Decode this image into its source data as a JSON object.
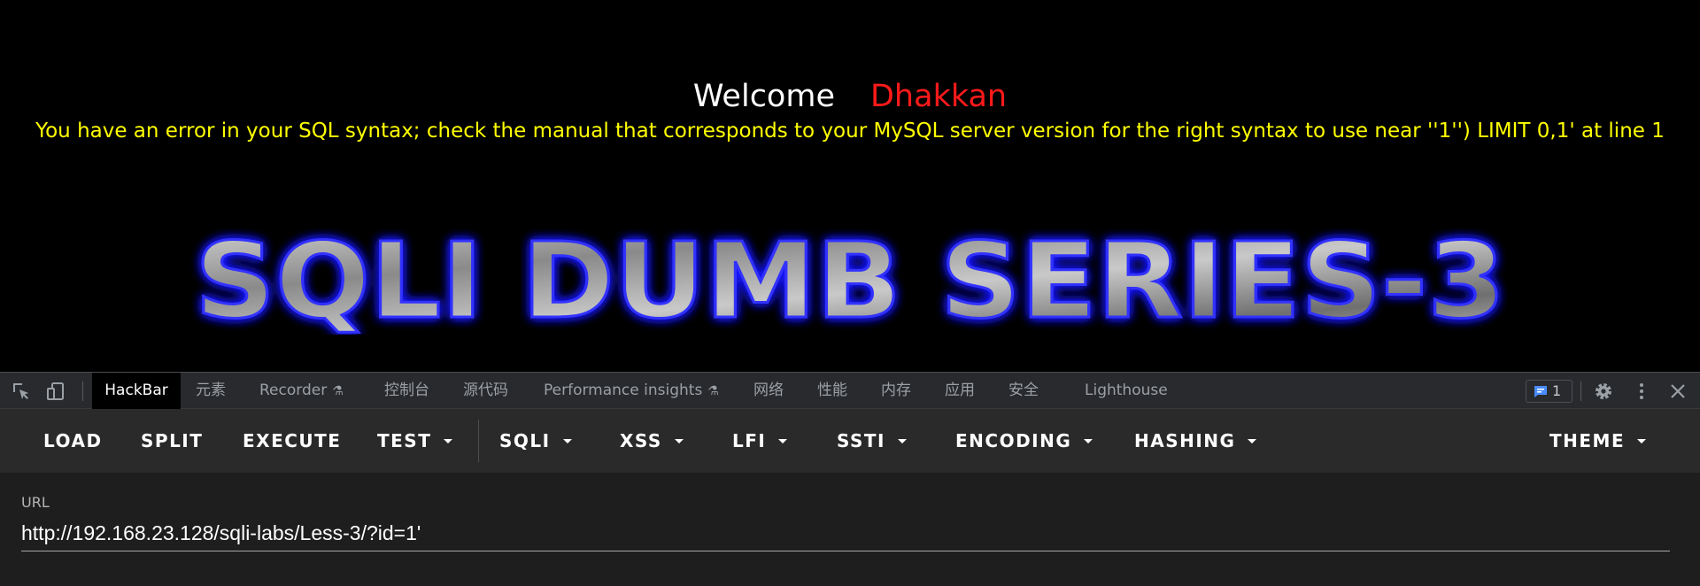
{
  "page": {
    "welcome_label": "Welcome",
    "username": "Dhakkan",
    "error_message": "You have an error in your SQL syntax; check the manual that corresponds to your MySQL server version for the right syntax to use near ''1'') LIMIT 0,1' at line 1",
    "banner_text": "SQLI DUMB SERIES-3",
    "colors": {
      "background": "#000000",
      "welcome": "#ffffff",
      "username": "#ff1a1a",
      "error": "#ffff00",
      "banner_glow": "#1a1aff"
    }
  },
  "devtools": {
    "tabs": [
      {
        "label": "HackBar",
        "active": true
      },
      {
        "label": "元素"
      },
      {
        "label": "Recorder",
        "icon": "flask-icon"
      },
      {
        "label": "控制台"
      },
      {
        "label": "源代码"
      },
      {
        "label": "Performance insights",
        "icon": "flask-icon"
      },
      {
        "label": "网络"
      },
      {
        "label": "性能"
      },
      {
        "label": "内存"
      },
      {
        "label": "应用"
      },
      {
        "label": "安全"
      },
      {
        "label": "Lighthouse"
      }
    ],
    "message_count": "1",
    "icons": [
      "inspect-icon",
      "device-toggle-icon",
      "message-icon",
      "settings-gear-icon",
      "more-vertical-icon",
      "close-icon"
    ]
  },
  "hackbar": {
    "buttons": [
      {
        "label": "LOAD"
      },
      {
        "label": "SPLIT"
      },
      {
        "label": "EXECUTE"
      },
      {
        "label": "TEST",
        "dropdown": true
      },
      {
        "label": "SQLI",
        "dropdown": true
      },
      {
        "label": "XSS",
        "dropdown": true
      },
      {
        "label": "LFI",
        "dropdown": true
      },
      {
        "label": "SSTI",
        "dropdown": true
      },
      {
        "label": "ENCODING",
        "dropdown": true
      },
      {
        "label": "HASHING",
        "dropdown": true
      },
      {
        "label": "THEME",
        "dropdown": true
      }
    ],
    "url_label": "URL",
    "url_value": "http://192.168.23.128/sqli-labs/Less-3/?id=1'"
  }
}
